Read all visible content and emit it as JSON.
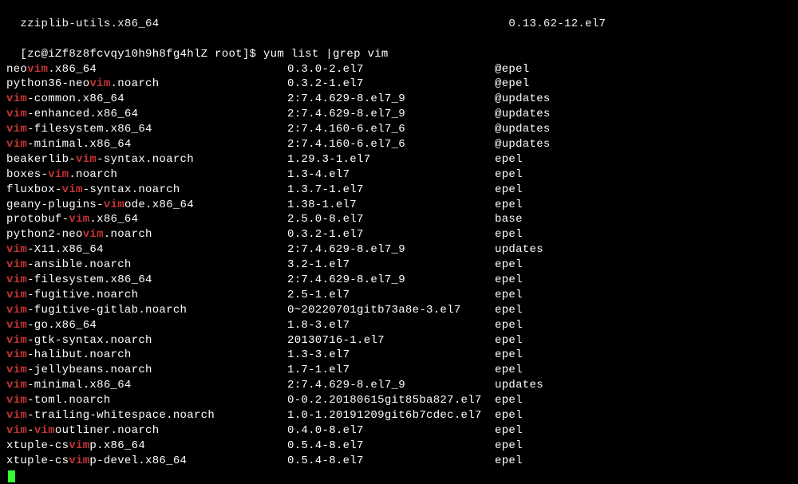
{
  "topPartial": {
    "pkg": "zziplib-utils.x86_64",
    "ver": "0.13.62-12.el7"
  },
  "prompt": {
    "prefix": "[zc@iZf8z8fcvqy10h9h8fg4hlZ root]$ ",
    "command": "yum list |grep vim"
  },
  "rows": [
    {
      "pre": "neo",
      "hl": "vim",
      "post": ".x86_64",
      "ver": "0.3.0-2.el7",
      "repo": "@epel"
    },
    {
      "pre": "python36-neo",
      "hl": "vim",
      "post": ".noarch",
      "ver": "0.3.2-1.el7",
      "repo": "@epel"
    },
    {
      "pre": "",
      "hl": "vim",
      "post": "-common.x86_64",
      "ver": "2:7.4.629-8.el7_9",
      "repo": "@updates"
    },
    {
      "pre": "",
      "hl": "vim",
      "post": "-enhanced.x86_64",
      "ver": "2:7.4.629-8.el7_9",
      "repo": "@updates"
    },
    {
      "pre": "",
      "hl": "vim",
      "post": "-filesystem.x86_64",
      "ver": "2:7.4.160-6.el7_6",
      "repo": "@updates"
    },
    {
      "pre": "",
      "hl": "vim",
      "post": "-minimal.x86_64",
      "ver": "2:7.4.160-6.el7_6",
      "repo": "@updates"
    },
    {
      "pre": "beakerlib-",
      "hl": "vim",
      "post": "-syntax.noarch",
      "ver": "1.29.3-1.el7",
      "repo": "epel"
    },
    {
      "pre": "boxes-",
      "hl": "vim",
      "post": ".noarch",
      "ver": "1.3-4.el7",
      "repo": "epel"
    },
    {
      "pre": "fluxbox-",
      "hl": "vim",
      "post": "-syntax.noarch",
      "ver": "1.3.7-1.el7",
      "repo": "epel"
    },
    {
      "pre": "geany-plugins-",
      "hl": "vim",
      "post": "ode.x86_64",
      "ver": "1.38-1.el7",
      "repo": "epel"
    },
    {
      "pre": "protobuf-",
      "hl": "vim",
      "post": ".x86_64",
      "ver": "2.5.0-8.el7",
      "repo": "base"
    },
    {
      "pre": "python2-neo",
      "hl": "vim",
      "post": ".noarch",
      "ver": "0.3.2-1.el7",
      "repo": "epel"
    },
    {
      "pre": "",
      "hl": "vim",
      "post": "-X11.x86_64",
      "ver": "2:7.4.629-8.el7_9",
      "repo": "updates"
    },
    {
      "pre": "",
      "hl": "vim",
      "post": "-ansible.noarch",
      "ver": "3.2-1.el7",
      "repo": "epel"
    },
    {
      "pre": "",
      "hl": "vim",
      "post": "-filesystem.x86_64",
      "ver": "2:7.4.629-8.el7_9",
      "repo": "epel"
    },
    {
      "pre": "",
      "hl": "vim",
      "post": "-fugitive.noarch",
      "ver": "2.5-1.el7",
      "repo": "epel"
    },
    {
      "pre": "",
      "hl": "vim",
      "post": "-fugitive-gitlab.noarch",
      "ver": "0~20220701gitb73a8e-3.el7",
      "repo": "epel"
    },
    {
      "pre": "",
      "hl": "vim",
      "post": "-go.x86_64",
      "ver": "1.8-3.el7",
      "repo": "epel"
    },
    {
      "pre": "",
      "hl": "vim",
      "post": "-gtk-syntax.noarch",
      "ver": "20130716-1.el7",
      "repo": "epel"
    },
    {
      "pre": "",
      "hl": "vim",
      "post": "-halibut.noarch",
      "ver": "1.3-3.el7",
      "repo": "epel"
    },
    {
      "pre": "",
      "hl": "vim",
      "post": "-jellybeans.noarch",
      "ver": "1.7-1.el7",
      "repo": "epel"
    },
    {
      "pre": "",
      "hl": "vim",
      "post": "-minimal.x86_64",
      "ver": "2:7.4.629-8.el7_9",
      "repo": "updates"
    },
    {
      "pre": "",
      "hl": "vim",
      "post": "-toml.noarch",
      "ver": "0-0.2.20180615git85ba827.el7",
      "repo": "epel"
    },
    {
      "pre": "",
      "hl": "vim",
      "post": "-trailing-whitespace.noarch",
      "ver": "1.0-1.20191209git6b7cdec.el7",
      "repo": "epel"
    },
    {
      "pre": "",
      "hl": "vim",
      "post": "-",
      "hl2": "vim",
      "post2": "outliner.noarch",
      "ver": "0.4.0-8.el7",
      "repo": "epel"
    },
    {
      "pre": "xtuple-cs",
      "hl": "vim",
      "post": "p.x86_64",
      "ver": "0.5.4-8.el7",
      "repo": "epel"
    },
    {
      "pre": "xtuple-cs",
      "hl": "vim",
      "post": "p-devel.x86_64",
      "ver": "0.5.4-8.el7",
      "repo": "epel"
    }
  ]
}
